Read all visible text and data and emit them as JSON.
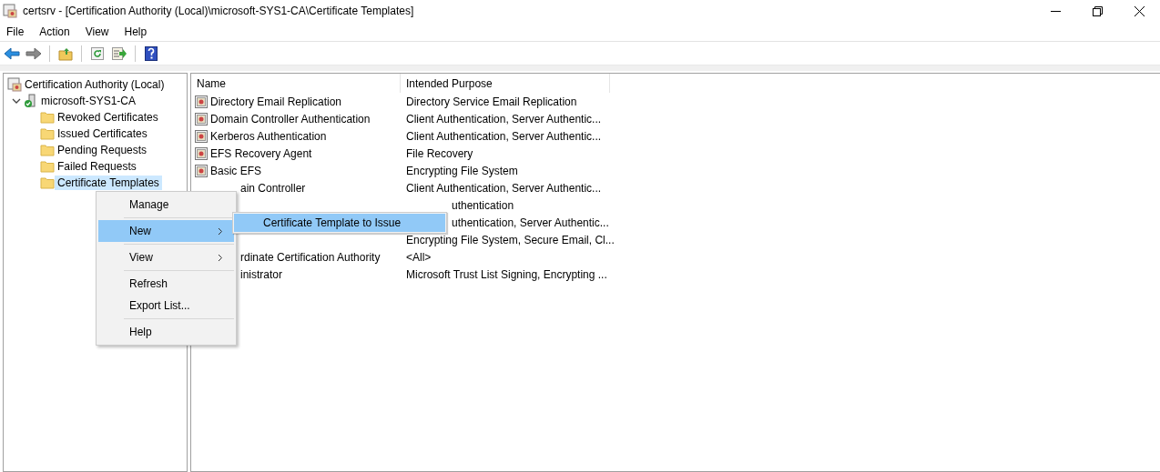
{
  "window": {
    "title": "certsrv - [Certification Authority (Local)\\microsoft-SYS1-CA\\Certificate Templates]"
  },
  "menu_bar": [
    "File",
    "Action",
    "View",
    "Help"
  ],
  "tree": [
    {
      "label": "Certification Authority (Local)",
      "kind": "authority",
      "selected": false,
      "children": [
        {
          "label": "microsoft-SYS1-CA",
          "kind": "server",
          "expanded": true,
          "selected": false,
          "children": [
            {
              "label": "Revoked Certificates",
              "kind": "folder",
              "selected": false
            },
            {
              "label": "Issued Certificates",
              "kind": "folder",
              "selected": false
            },
            {
              "label": "Pending Requests",
              "kind": "folder",
              "selected": false
            },
            {
              "label": "Failed Requests",
              "kind": "folder",
              "selected": false
            },
            {
              "label": "Certificate Templates",
              "kind": "folder",
              "selected": true
            }
          ]
        }
      ]
    }
  ],
  "table": {
    "columns": [
      "Name",
      "Intended Purpose"
    ],
    "rows": [
      {
        "name": "Directory Email Replication",
        "purpose": "Directory Service Email Replication",
        "name_covered": false,
        "purpose_covered": false
      },
      {
        "name": "Domain Controller Authentication",
        "purpose": "Client Authentication, Server Authentic...",
        "name_covered": false,
        "purpose_covered": false
      },
      {
        "name": "Kerberos Authentication",
        "purpose": "Client Authentication, Server Authentic...",
        "name_covered": false,
        "purpose_covered": false
      },
      {
        "name": "EFS Recovery Agent",
        "purpose": "File Recovery",
        "name_covered": false,
        "purpose_covered": false
      },
      {
        "name": "Basic EFS",
        "purpose": "Encrypting File System",
        "name_covered": false,
        "purpose_covered": false
      },
      {
        "name": "ain Controller",
        "purpose": "Client Authentication, Server Authentic...",
        "name_covered": true,
        "purpose_covered": false
      },
      {
        "purpose": "uthentication",
        "purpose_covered": true
      },
      {
        "purpose": "uthentication, Server Authentic...",
        "purpose_covered": true
      },
      {
        "purpose": "Encrypting File System, Secure Email, Cl...",
        "purpose_covered": false
      },
      {
        "name": "rdinate Certification Authority",
        "purpose": "<All>",
        "name_covered": true,
        "purpose_covered": false
      },
      {
        "name": "inistrator",
        "purpose": "Microsoft Trust List Signing, Encrypting ...",
        "name_covered": true,
        "purpose_covered": false
      }
    ]
  },
  "context_menu": {
    "groups": [
      [
        {
          "label": "Manage",
          "submenu": false,
          "selected": false
        }
      ],
      [
        {
          "label": "New",
          "submenu": true,
          "selected": true
        }
      ],
      [
        {
          "label": "View",
          "submenu": true,
          "selected": false
        }
      ],
      [
        {
          "label": "Refresh",
          "submenu": false,
          "selected": false
        },
        {
          "label": "Export List...",
          "submenu": false,
          "selected": false
        }
      ],
      [
        {
          "label": "Help",
          "submenu": false,
          "selected": false
        }
      ]
    ]
  },
  "submenu": {
    "items": [
      {
        "label": "Certificate Template to Issue",
        "selected": true
      }
    ]
  }
}
